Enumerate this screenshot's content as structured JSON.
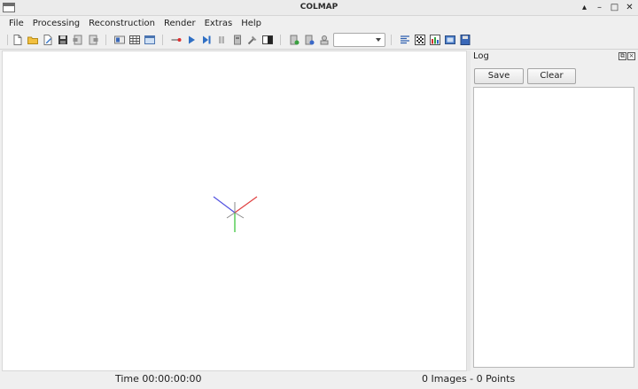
{
  "window": {
    "title": "COLMAP",
    "controls": [
      "▴",
      "–",
      "□",
      "✕"
    ]
  },
  "menu": [
    "File",
    "Processing",
    "Reconstruction",
    "Render",
    "Extras",
    "Help"
  ],
  "toolbar": {
    "icons": [
      "new-project",
      "open-project",
      "edit-project",
      "save-project",
      "import-model",
      "export-model",
      "feature-extraction",
      "feature-matching",
      "database-management",
      "reconstruction-start",
      "reconstruction-step",
      "reconstruction-pause",
      "reconstruction-reset",
      "render-options",
      "normalize-model",
      "bundle-adjustment",
      "dense-reconstruction",
      "grab-image",
      "render-mode",
      "match-matrix",
      "reconstruction-stats",
      "grab-movie",
      "save-log"
    ],
    "combo_value": ""
  },
  "log": {
    "title": "Log",
    "save_label": "Save",
    "clear_label": "Clear",
    "content": ""
  },
  "status": {
    "time": "Time 00:00:00:00",
    "counts": "0 Images - 0 Points"
  },
  "colors": {
    "axis_x": "#e04040",
    "axis_y": "#30c030",
    "axis_z": "#5050e0"
  }
}
